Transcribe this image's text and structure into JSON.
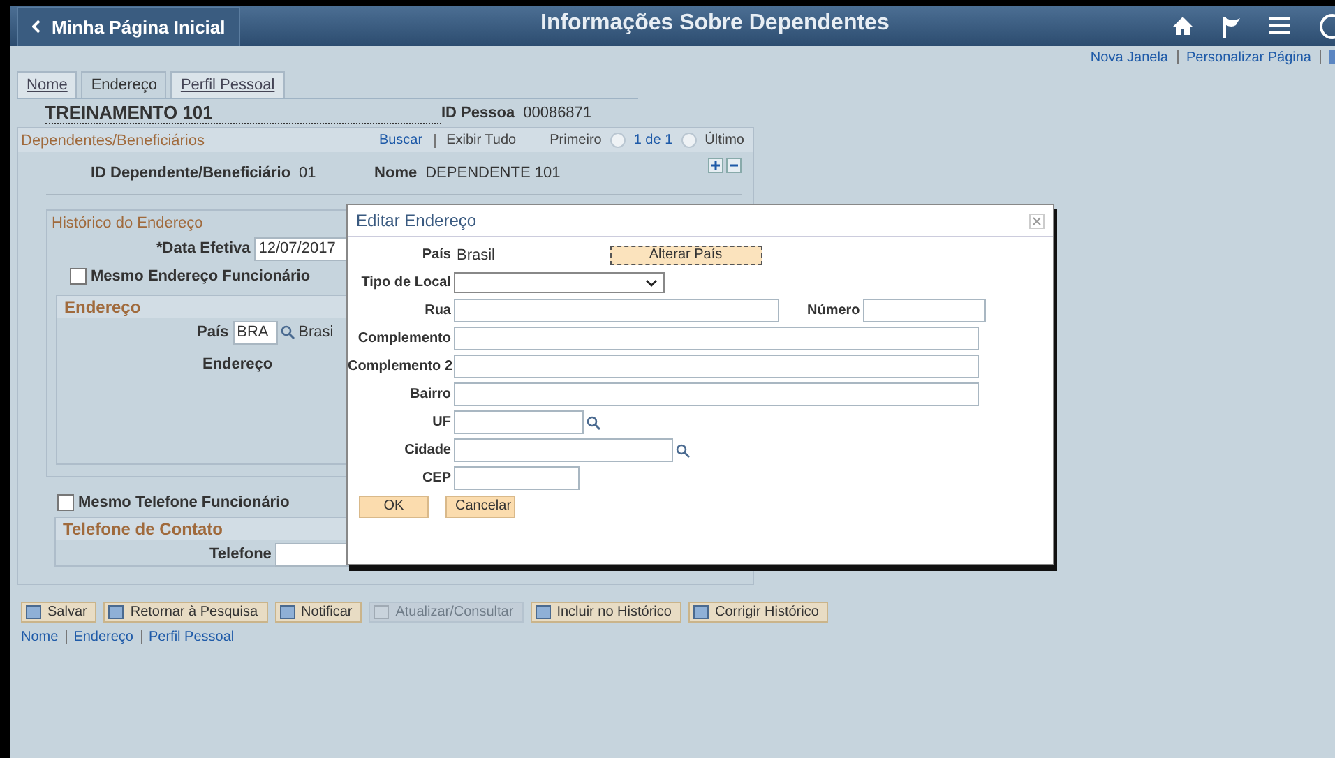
{
  "header": {
    "back_label": "Minha Página Inicial",
    "title": "Informações Sobre Dependentes"
  },
  "top_links": [
    "Nova Janela",
    "Personalizar Página"
  ],
  "tabs": [
    {
      "label": "Nome",
      "selected": false
    },
    {
      "label": "Endereço",
      "selected": true
    },
    {
      "label": "Perfil Pessoal",
      "selected": false
    }
  ],
  "person": {
    "name": "TREINAMENTO 101",
    "id_label": "ID Pessoa",
    "id_value": "00086871"
  },
  "dependents": {
    "title": "Dependentes/Beneficiários",
    "search": "Buscar",
    "show_all": "Exibir Tudo",
    "first": "Primeiro",
    "count": "1 de 1",
    "last": "Último",
    "id_label": "ID Dependente/Beneficiário",
    "id_value": "01",
    "name_label": "Nome",
    "name_value": "DEPENDENTE 101"
  },
  "history": {
    "title": "Histórico do Endereço",
    "date_label": "*Data Efetiva",
    "date_value": "12/07/2017",
    "same_address": {
      "label": "Mesmo Endereço Funcionário",
      "checked": false
    },
    "address_title": "Endereço",
    "country_label": "País",
    "country_code": "BRA",
    "country_name": "Brasi",
    "address_label": "Endereço",
    "same_phone": {
      "label": "Mesmo Telefone Funcionário",
      "checked": false
    },
    "phone_title": "Telefone de Contato",
    "phone_label": "Telefone"
  },
  "toolbar": [
    {
      "label": "Salvar",
      "disabled": false
    },
    {
      "label": "Retornar à Pesquisa",
      "disabled": false
    },
    {
      "label": "Notificar",
      "disabled": false
    },
    {
      "label": "Atualizar/Consultar",
      "disabled": true
    },
    {
      "label": "Incluir no Histórico",
      "disabled": false
    },
    {
      "label": "Corrigir Histórico",
      "disabled": false
    }
  ],
  "bottom_links": [
    "Nome",
    "Endereço",
    "Perfil Pessoal"
  ],
  "modal": {
    "title": "Editar Endereço",
    "country_label": "País",
    "country_value": "Brasil",
    "change_button": "Alterar País",
    "rows": [
      [
        {
          "label": "Tipo de Local",
          "kind": "select"
        }
      ],
      [
        {
          "label": "Rua",
          "kind": "street"
        },
        {
          "label": "Número",
          "kind": "number"
        }
      ],
      [
        {
          "label": "Complemento",
          "kind": "long"
        }
      ],
      [
        {
          "label": "Complemento 2",
          "kind": "long"
        }
      ],
      [
        {
          "label": "Bairro",
          "kind": "long"
        }
      ],
      [
        {
          "label": "UF",
          "kind": "state"
        }
      ],
      [
        {
          "label": "Cidade",
          "kind": "city"
        }
      ],
      [
        {
          "label": "CEP",
          "kind": "postal"
        }
      ]
    ],
    "ok": "OK",
    "cancel": "Cancelar"
  }
}
